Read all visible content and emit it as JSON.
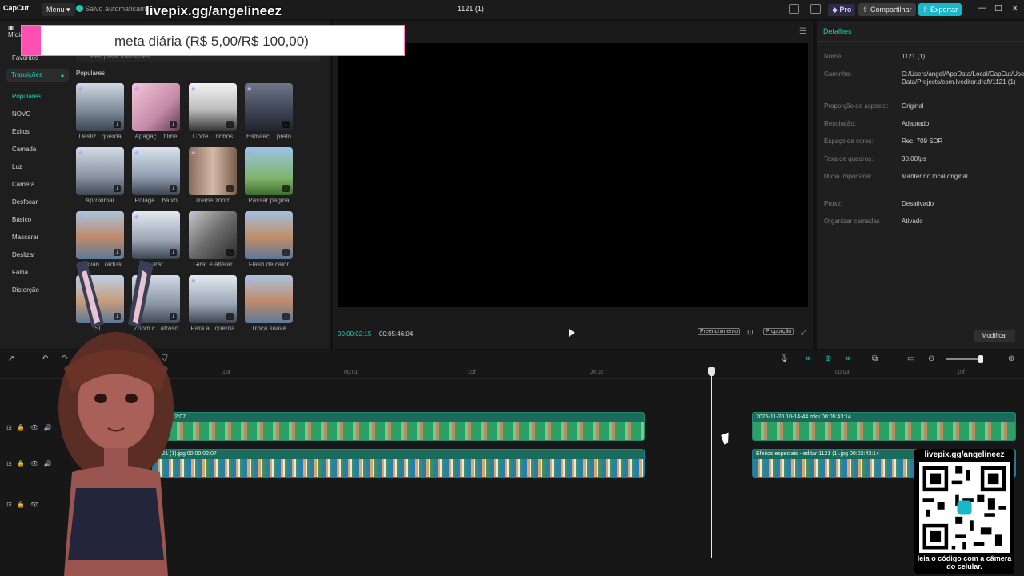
{
  "titlebar": {
    "logo": "CapCut",
    "menu_label": "Menu",
    "saved_status": "Salvo automaticam",
    "project_title": "1121 (1)",
    "pro_label": "Pro",
    "share_label": "Compartilhar",
    "export_label": "Exportar"
  },
  "overlay": {
    "url": "livepix.gg/angelineez",
    "goal": "meta diária (R$ 5,00/R$ 100,00)"
  },
  "sidebar": {
    "media_tab": "Mídia",
    "search_placeholder": "Pesquisar transições",
    "favorites": "Favoritos",
    "category": "Transições",
    "items": [
      "Populares",
      "NOVO",
      "Exitos",
      "Camada",
      "Luz",
      "Câmera",
      "Desfocar",
      "Básico",
      "Mascarar",
      "Deslizar",
      "Falha",
      "Distorção"
    ]
  },
  "gallery": {
    "section_title": "Populares",
    "items": [
      {
        "label": "Desliz...querda"
      },
      {
        "label": "Apagaç... filme"
      },
      {
        "label": "Corte ...rinhos"
      },
      {
        "label": "Esmaec... preto"
      },
      {
        "label": "Aproximar"
      },
      {
        "label": "Rolage... baixo"
      },
      {
        "label": "Treme zoom"
      },
      {
        "label": "Passar página"
      },
      {
        "label": "Desvan...radual"
      },
      {
        "label": "Girar"
      },
      {
        "label": "Girar e alterar"
      },
      {
        "label": "Flash de calor"
      },
      {
        "label": "Sl..."
      },
      {
        "label": "Zoom c...atraso"
      },
      {
        "label": "Para a...querda"
      },
      {
        "label": "Troca suave"
      }
    ]
  },
  "preview": {
    "current_time": "00:00:02:15",
    "total_time": "00:05:46:04",
    "fill_label": "Preenchimento",
    "ratio_label": "Proporção"
  },
  "details": {
    "title": "Detalhes",
    "rows": [
      {
        "label": "Nome:",
        "value": "1121 (1)"
      },
      {
        "label": "Caminho:",
        "value": "C:/Users/angel/AppData/Local/CapCut/User Data/Projects/com.lveditor.draft/1121 (1)"
      },
      {
        "label": "Proporção de aspecto:",
        "value": "Original"
      },
      {
        "label": "Resolução:",
        "value": "Adaptado"
      },
      {
        "label": "Espaço de cores:",
        "value": "Rec. 709 SDR"
      },
      {
        "label": "Taxa de quadros:",
        "value": "30.00fps"
      },
      {
        "label": "Mídia importada:",
        "value": "Manter no local original"
      },
      {
        "label": "Proxy:",
        "value": "Desativado"
      },
      {
        "label": "Organizar camadas",
        "value": "Ativado"
      }
    ],
    "modify_label": "Modificar"
  },
  "timeline": {
    "ruler_ticks": [
      "15f",
      "00:01",
      "15f",
      "00:02",
      "00:03",
      "15f"
    ],
    "clips": [
      {
        "title": "00:00:02:07"
      },
      {
        "title": "2025-11-20 10-14-44.mkv  00:05:43:14"
      },
      {
        "title": "1121 (1).jpg  00:00:02:07"
      },
      {
        "title": "Efeitos especiais - editar  1121 (1).jpg  00:02:43:14"
      }
    ]
  },
  "qr": {
    "url": "livepix.gg/angelineez",
    "caption": "leia o código com a câmera do celular."
  },
  "colors": {
    "accent": "#1fd1c2",
    "export": "#19b7c9",
    "goal_bar": "#ff4fb1"
  }
}
